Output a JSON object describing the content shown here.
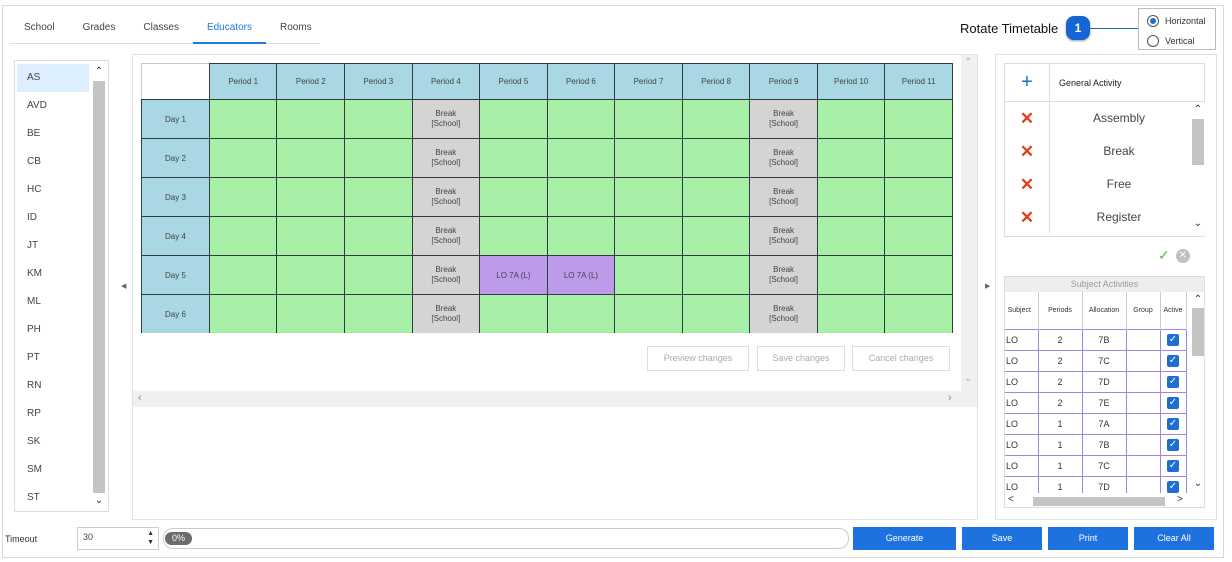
{
  "tabs": [
    {
      "label": "School"
    },
    {
      "label": "Grades"
    },
    {
      "label": "Classes"
    },
    {
      "label": "Educators"
    },
    {
      "label": "Rooms"
    }
  ],
  "rotate": {
    "label": "Rotate Timetable",
    "badge": "1",
    "options": [
      {
        "label": "Horizontal",
        "checked": true
      },
      {
        "label": "Vertical",
        "checked": false
      }
    ]
  },
  "educators": [
    "AS",
    "AVD",
    "BE",
    "CB",
    "HC",
    "ID",
    "JT",
    "KM",
    "ML",
    "PH",
    "PT",
    "RN",
    "RP",
    "SK",
    "SM",
    "ST"
  ],
  "selected_educator": "AS",
  "timetable": {
    "periods": [
      "Period 1",
      "Period 2",
      "Period 3",
      "Period 4",
      "Period 5",
      "Period 6",
      "Period 7",
      "Period 8",
      "Period 9",
      "Period 10",
      "Period 11"
    ],
    "days": [
      "Day 1",
      "Day 2",
      "Day 3",
      "Day 4",
      "Day 5",
      "Day 6"
    ],
    "break_line1": "Break",
    "break_line2": "[School]",
    "break_periods": [
      "Period 4",
      "Period 9"
    ],
    "lessons": [
      {
        "day": "Day 5",
        "period": "Period 5",
        "text": "LO 7A (L)"
      },
      {
        "day": "Day 5",
        "period": "Period 6",
        "text": "LO 7A (L)"
      }
    ]
  },
  "grid_buttons": {
    "preview": "Preview changes",
    "save": "Save changes",
    "cancel": "Cancel changes"
  },
  "activities": {
    "header": "General Activity",
    "items": [
      "Assembly",
      "Break",
      "Free",
      "Register"
    ]
  },
  "subject_activities": {
    "title": "Subject Activities",
    "columns": [
      "Subject",
      "Periods",
      "Allocation",
      "Group",
      "Active"
    ],
    "rows": [
      {
        "subject": "LO",
        "periods": "2",
        "allocation": "7B",
        "group": "",
        "active": true
      },
      {
        "subject": "LO",
        "periods": "2",
        "allocation": "7C",
        "group": "",
        "active": true
      },
      {
        "subject": "LO",
        "periods": "2",
        "allocation": "7D",
        "group": "",
        "active": true
      },
      {
        "subject": "LO",
        "periods": "2",
        "allocation": "7E",
        "group": "",
        "active": true
      },
      {
        "subject": "LO",
        "periods": "1",
        "allocation": "7A",
        "group": "",
        "active": true
      },
      {
        "subject": "LO",
        "periods": "1",
        "allocation": "7B",
        "group": "",
        "active": true
      },
      {
        "subject": "LO",
        "periods": "1",
        "allocation": "7C",
        "group": "",
        "active": true
      },
      {
        "subject": "LO",
        "periods": "1",
        "allocation": "7D",
        "group": "",
        "active": true
      }
    ]
  },
  "bottom": {
    "timeout_label": "Timeout",
    "timeout_value": "30",
    "progress_text": "0%",
    "generate": "Generate",
    "save": "Save",
    "print": "Print",
    "clear_all": "Clear All"
  },
  "colors": {
    "accent": "#1e72e0",
    "empty_cell": "#a8efa8",
    "break_cell": "#d4d4d4",
    "lesson_cell": "#bb9bea",
    "header_cell": "#a9d7e3"
  }
}
